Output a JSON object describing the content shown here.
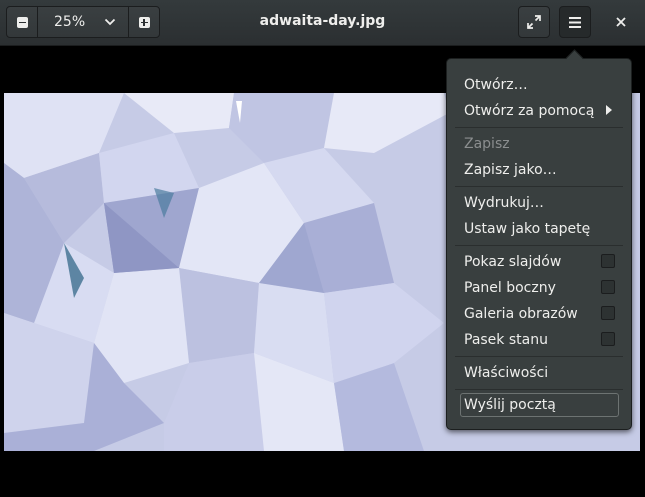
{
  "header": {
    "title": "adwaita-day.jpg",
    "zoom": {
      "value": "25%",
      "zoom_out_icon": "zoom-out-icon",
      "zoom_in_icon": "zoom-in-icon",
      "dropdown_icon": "chevron-down-icon"
    },
    "fullscreen_icon": "fullscreen-icon",
    "menu_icon": "hamburger-menu-icon",
    "close_icon": "close-icon"
  },
  "image": {
    "description_icon": "adwaita-day-wallpaper"
  },
  "menu": {
    "open": "Otwórz…",
    "open_with": "Otwórz za pomocą",
    "save": "Zapisz",
    "save_as": "Zapisz jako…",
    "print": "Wydrukuj…",
    "set_wallpaper": "Ustaw jako tapetę",
    "slideshow": "Pokaz slajdów",
    "sidebar": "Panel boczny",
    "gallery": "Galeria obrazów",
    "statusbar": "Pasek stanu",
    "properties": "Właściwości",
    "send_email": "Wyślij pocztą"
  },
  "colors": {
    "headerbar": "#2f3436",
    "popover": "#393f3f",
    "text": "#eeeeec",
    "disabled_text": "#8b8e8f"
  }
}
